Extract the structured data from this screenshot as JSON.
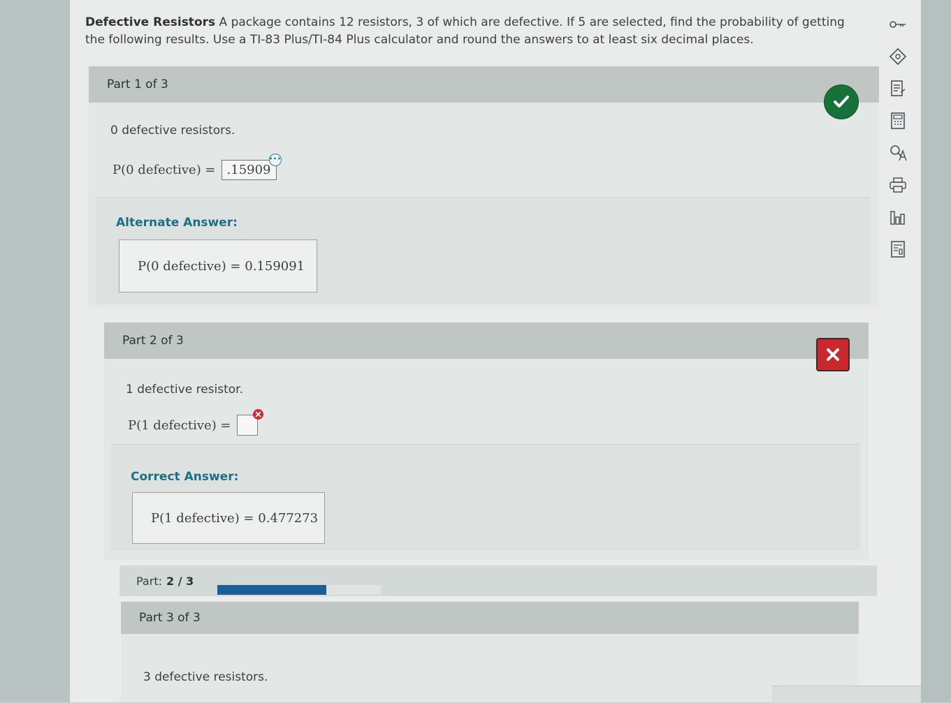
{
  "problem": {
    "title": "Defective Resistors",
    "text_line1": "A package contains 12 resistors, 3 of which are defective. If 5 are selected, find the probability of getting",
    "text_line2": "the following results. Use a TI-83 Plus/TI-84 Plus calculator and round the answers to at least six decimal places."
  },
  "part1": {
    "header": "Part 1 of 3",
    "question": "0 defective resistors.",
    "eq_label": "P(0 defective) =",
    "answer": ".15909",
    "status": "correct",
    "alt_title": "Alternate Answer:",
    "alt_answer": "P(0 defective) = 0.159091"
  },
  "part2": {
    "header": "Part 2 of 3",
    "question": "1 defective resistor.",
    "eq_label": "P(1 defective) =",
    "answer": "",
    "status": "incorrect",
    "correct_title": "Correct Answer:",
    "correct_answer": "P(1 defective) = 0.477273"
  },
  "progress": {
    "label": "Part:",
    "value": "2 / 3",
    "fraction": 0.667
  },
  "part3": {
    "header": "Part 3 of 3",
    "question": "3 defective resistors."
  },
  "colors": {
    "correct": "#17723a",
    "incorrect": "#c9282d",
    "accent": "#1d6f86",
    "progress": "#1b5f94"
  },
  "toolbar_icons": [
    "key-icon",
    "tag-icon",
    "notes-icon",
    "calculator-icon",
    "glossary-icon",
    "print-icon",
    "chart-icon",
    "formula-sheet-icon"
  ]
}
